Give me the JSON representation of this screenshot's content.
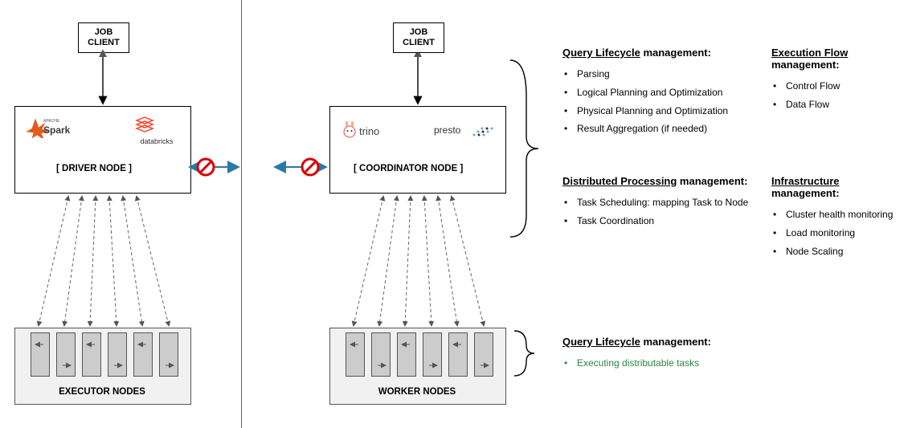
{
  "left": {
    "job_client": "JOB\nCLIENT",
    "logo1_label": "Spark",
    "logo2_label": "databricks",
    "node_label": "[    DRIVER NODE    ]",
    "bottom_label": "EXECUTOR NODES"
  },
  "right": {
    "job_client": "JOB\nCLIENT",
    "logo1_label": "trino",
    "logo2_label": "presto",
    "node_label": "[  COORDINATOR NODE  ]",
    "bottom_label": "WORKER NODES"
  },
  "text": {
    "query_lifecycle": {
      "title_u": "Query Lifecycle",
      "title_rest": " management:",
      "items": [
        "Parsing",
        "Logical Planning and Optimization",
        "Physical Planning and Optimization",
        "Result Aggregation (if needed)"
      ]
    },
    "execution_flow": {
      "title_u": "Execution Flow",
      "title_rest": " management:",
      "items": [
        "Control Flow",
        "Data Flow"
      ]
    },
    "distributed": {
      "title_u": "Distributed  Processing",
      "title_rest": " management:",
      "items": [
        "Task Scheduling: mapping Task to Node",
        "Task Coordination"
      ]
    },
    "infrastructure": {
      "title_u": "Infrastructure",
      "title_rest": " management:",
      "items": [
        "Cluster health monitoring",
        "Load monitoring",
        "Node Scaling"
      ]
    },
    "bottom": {
      "title_u": "Query Lifecycle",
      "title_rest": " management:",
      "item": "Executing distributable tasks"
    }
  }
}
